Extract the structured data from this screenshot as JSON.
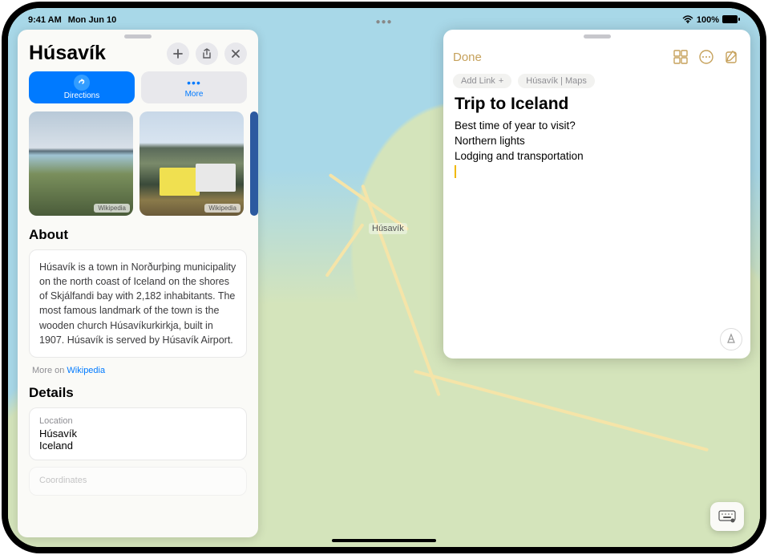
{
  "status": {
    "time": "9:41 AM",
    "date": "Mon Jun 10",
    "battery": "100%"
  },
  "map": {
    "place_label": "Húsavík"
  },
  "place": {
    "title": "Húsavík",
    "actions": {
      "directions": "Directions",
      "more": "More"
    },
    "photo_credit": "Wikipedia",
    "about_heading": "About",
    "about_text": "Húsavík is a town in Norðurþing municipality on the north coast of Iceland on the shores of Skjálfandi bay with 2,182 inhabitants. The most famous landmark of the town is the wooden church Húsavíkurkirkja, built in 1907. Húsavík is served by Húsavík Airport.",
    "more_on": "More on",
    "more_source": "Wikipedia",
    "details_heading": "Details",
    "detail_location": {
      "label": "Location",
      "value_line1": "Húsavík",
      "value_line2": "Iceland"
    },
    "detail_coords_label": "Coordinates"
  },
  "note": {
    "done": "Done",
    "add_link": "Add Link",
    "link_chip": "Húsavík | Maps",
    "title": "Trip to Iceland",
    "lines": [
      "Best time of year to visit?",
      "Northern lights",
      "Lodging and transportation"
    ]
  }
}
